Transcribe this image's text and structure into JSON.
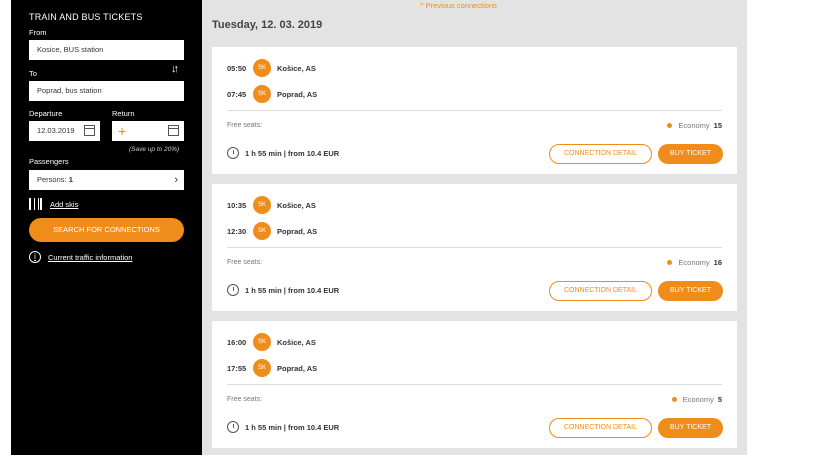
{
  "sidebar": {
    "title": "TRAIN AND BUS TICKETS",
    "from_label": "From",
    "from_value": "Kosice, BUS station",
    "to_label": "To",
    "to_value": "Poprad, bus station",
    "departure_label": "Departure",
    "return_label": "Return",
    "departure_value": "12.03.2019",
    "return_plus": "+",
    "save_note": "(Save up to 20%)",
    "passengers_label": "Passengers",
    "persons_prefix": "Persons: ",
    "persons_count": "1",
    "add_skis": "Add skis",
    "search_button": "SEARCH FOR CONNECTIONS",
    "traffic_info": "Current traffic information"
  },
  "main": {
    "previous_connections": "^ Previous connections",
    "date_heading": "Tuesday, 12. 03. 2019",
    "connections": [
      {
        "dep_time": "05:50",
        "dep_badge": "SK",
        "dep_station": "Košice, AS",
        "arr_time": "07:45",
        "arr_badge": "SK",
        "arr_station": "Poprad, AS",
        "free_seats_label": "Free seats:",
        "class": "Economy",
        "seats": "15",
        "summary": "1 h 55 min | from 10.4 EUR",
        "detail_button": "CONNECTION DETAIL",
        "buy_button": "BUY TICKET"
      },
      {
        "dep_time": "10:35",
        "dep_badge": "SK",
        "dep_station": "Košice, AS",
        "arr_time": "12:30",
        "arr_badge": "SK",
        "arr_station": "Poprad, AS",
        "free_seats_label": "Free seats:",
        "class": "Economy",
        "seats": "16",
        "summary": "1 h 55 min | from 10.4 EUR",
        "detail_button": "CONNECTION DETAIL",
        "buy_button": "BUY TICKET"
      },
      {
        "dep_time": "16:00",
        "dep_badge": "SK",
        "dep_station": "Košice, AS",
        "arr_time": "17:55",
        "arr_badge": "SK",
        "arr_station": "Poprad, AS",
        "free_seats_label": "Free seats:",
        "class": "Economy",
        "seats": "5",
        "summary": "1 h 55 min | from 10.4 EUR",
        "detail_button": "CONNECTION DETAIL",
        "buy_button": "BUY TICKET"
      }
    ]
  },
  "colors": {
    "accent": "#f08c1a",
    "sidebar_bg": "#000000",
    "main_bg": "#e3e3e3"
  }
}
